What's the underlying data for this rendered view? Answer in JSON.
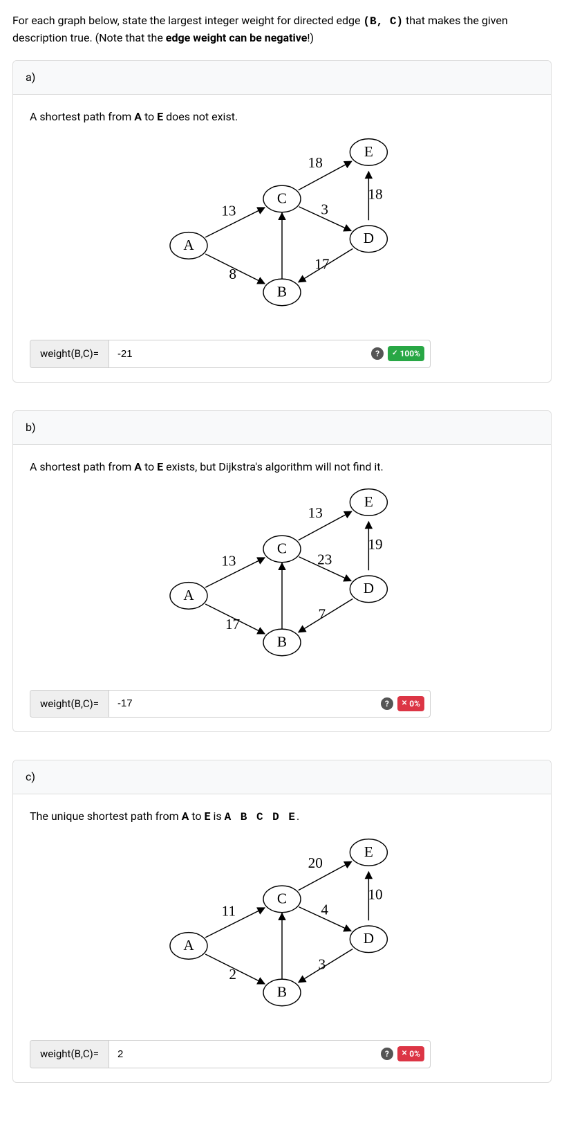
{
  "prompt": {
    "pre": "For each graph below, state the largest integer weight for directed edge ",
    "edge": "(B, C)",
    "mid": " that makes the given description true. (Note that the ",
    "bold": "edge weight can be negative",
    "post": "!)"
  },
  "parts": [
    {
      "label": "a)",
      "description_pre": "A shortest path from ",
      "n1": "A",
      "mid1": " to ",
      "n2": "E",
      "post": " does not exist.",
      "has_path": false,
      "answer_label": "weight(B,C)=",
      "answer_value": "-21",
      "badge_type": "green",
      "badge_icon": "✓",
      "badge_text": "100%",
      "graph": {
        "nodes": {
          "A": "A",
          "B": "B",
          "C": "C",
          "D": "D",
          "E": "E"
        },
        "edges": {
          "AC": "13",
          "AB": "8",
          "CE": "18",
          "CD": "3",
          "DB": "17",
          "DE": "18"
        }
      }
    },
    {
      "label": "b)",
      "description_pre": "A shortest path from ",
      "n1": "A",
      "mid1": " to ",
      "n2": "E",
      "post": " exists, but Dijkstra's algorithm will not find it.",
      "has_path": false,
      "answer_label": "weight(B,C)=",
      "answer_value": "-17",
      "badge_type": "red",
      "badge_icon": "✕",
      "badge_text": "0%",
      "graph": {
        "nodes": {
          "A": "A",
          "B": "B",
          "C": "C",
          "D": "D",
          "E": "E"
        },
        "edges": {
          "AC": "13",
          "AB": "17",
          "CE": "13",
          "CD": "23",
          "DB": "7",
          "DE": "19"
        }
      }
    },
    {
      "label": "c)",
      "description_pre": "The unique shortest path from ",
      "n1": "A",
      "mid1": " to ",
      "n2": "E",
      "mid2": " is  ",
      "path": "A B C D E",
      "post": ".",
      "has_path": true,
      "answer_label": "weight(B,C)=",
      "answer_value": "2",
      "badge_type": "red",
      "badge_icon": "✕",
      "badge_text": "0%",
      "graph": {
        "nodes": {
          "A": "A",
          "B": "B",
          "C": "C",
          "D": "D",
          "E": "E"
        },
        "edges": {
          "AC": "11",
          "AB": "2",
          "CE": "20",
          "CD": "4",
          "DB": "3",
          "DE": "10"
        }
      }
    }
  ]
}
